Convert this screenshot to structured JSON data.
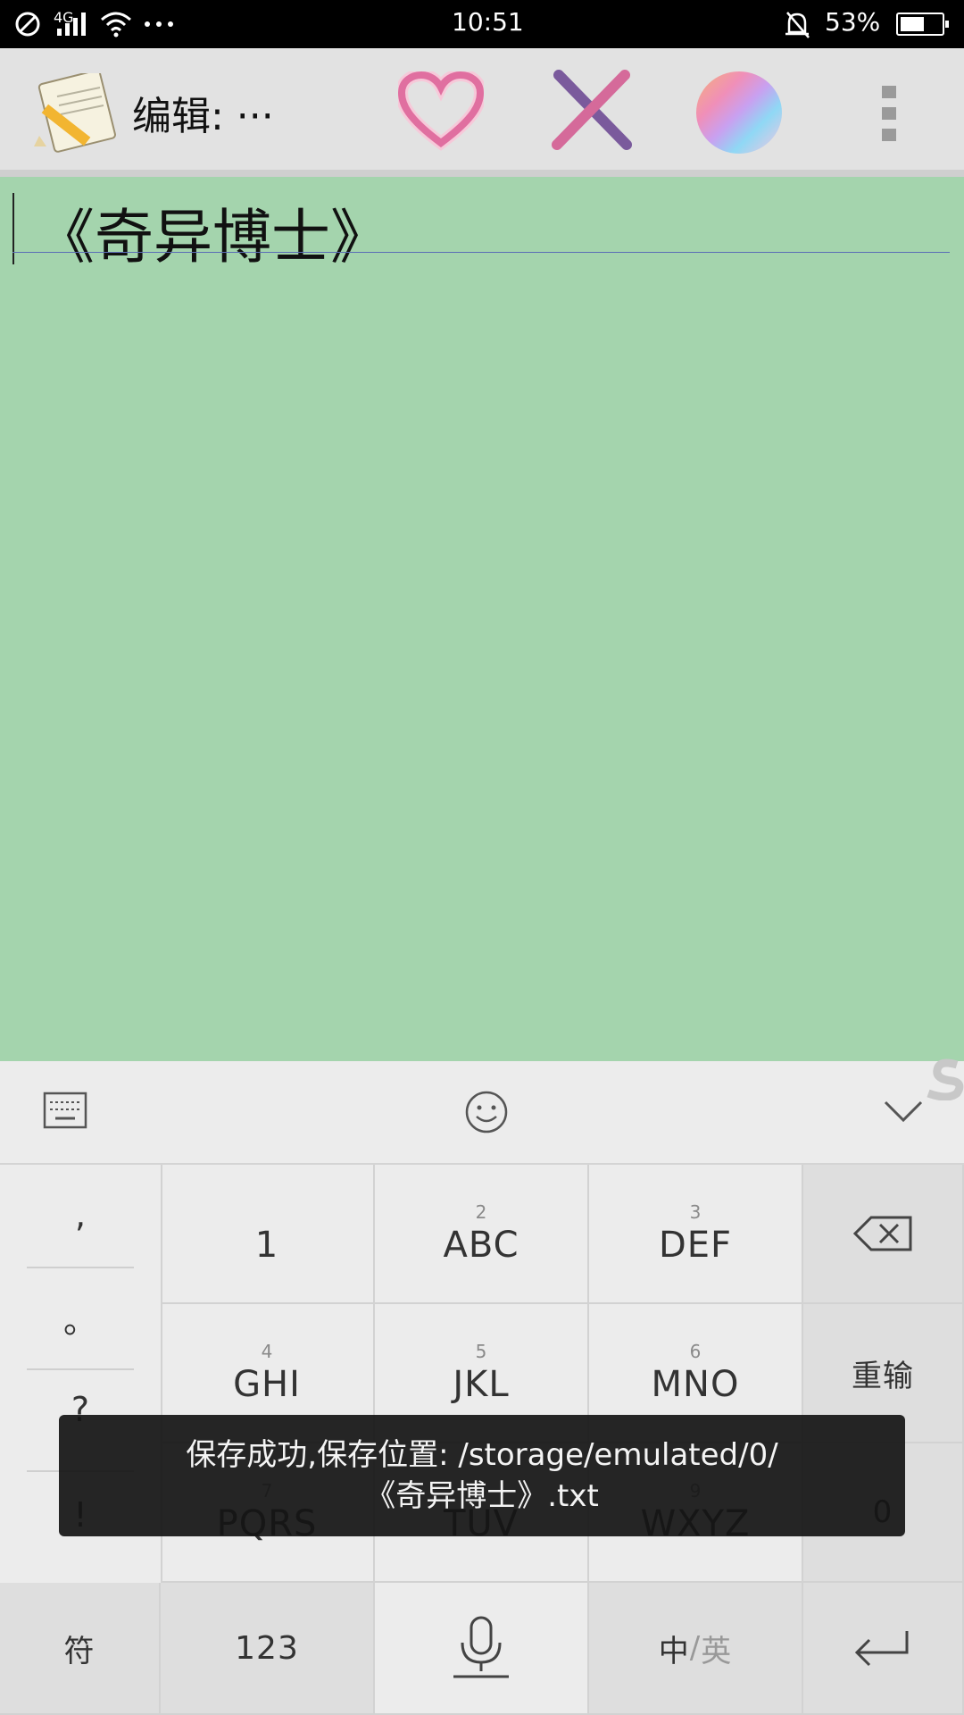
{
  "status_bar": {
    "network": "4G",
    "time": "10:51",
    "battery": "53%",
    "icons": [
      "no-disturb-icon",
      "signal-icon",
      "wifi-icon",
      "more-dots-icon",
      "alarm-off-icon",
      "battery-icon"
    ]
  },
  "app_bar": {
    "title": "编辑: ···",
    "icons": [
      "notepad-app-icon",
      "heart-icon",
      "close-x-icon",
      "color-orb-icon",
      "overflow-menu-icon"
    ]
  },
  "editor": {
    "text": "《奇异博士》"
  },
  "keyboard": {
    "toolbar_icons": [
      "keyboard-icon",
      "emoji-icon",
      "chevron-down-icon"
    ],
    "punctuation": [
      ",",
      "。",
      "?",
      "!"
    ],
    "keys": [
      {
        "num": "",
        "label": "1"
      },
      {
        "num": "2",
        "label": "ABC"
      },
      {
        "num": "3",
        "label": "DEF"
      },
      {
        "num": "4",
        "label": "GHI"
      },
      {
        "num": "5",
        "label": "JKL"
      },
      {
        "num": "6",
        "label": "MNO"
      },
      {
        "num": "7",
        "label": "PQRS"
      },
      {
        "num": "8",
        "label": "TUV"
      },
      {
        "num": "9",
        "label": "WXYZ"
      }
    ],
    "retype": "重输",
    "zero": "0",
    "symbol": "符",
    "num_mode": "123",
    "lang_zh": "中",
    "lang_sep": "/",
    "lang_en": "英"
  },
  "toast": {
    "line1": "保存成功,保存位置: /storage/emulated/0/",
    "line2": "《奇异博士》.txt"
  },
  "colors": {
    "editor_bg": "#a4d4ad",
    "heart": "#e06fa0",
    "close_x_pink": "#d56a9a",
    "close_x_purple": "#7a5a9c"
  }
}
